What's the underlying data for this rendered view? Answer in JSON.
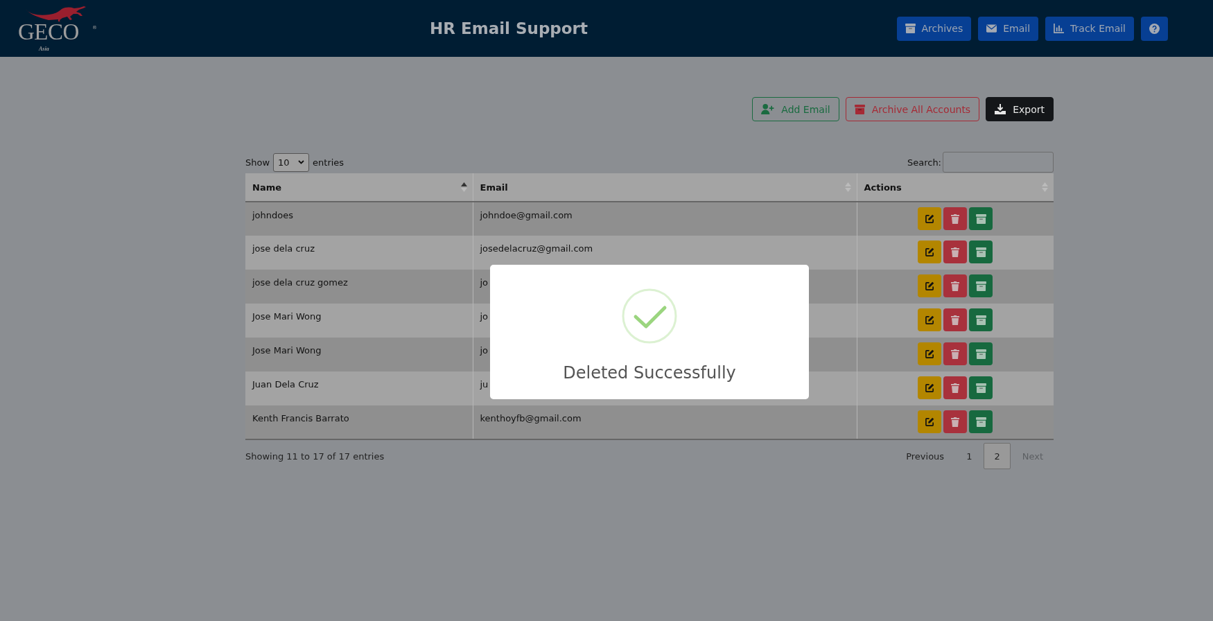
{
  "header": {
    "logo": {
      "name": "GECO",
      "registered": "®",
      "region": "Asia"
    },
    "title": "HR Email Support",
    "buttons": [
      {
        "kind": "archive",
        "label": "Archives"
      },
      {
        "kind": "email",
        "label": "Email"
      },
      {
        "kind": "chart",
        "label": "Track Email"
      },
      {
        "kind": "help"
      }
    ]
  },
  "toolbar": [
    {
      "kind": "add",
      "label": "Add Email"
    },
    {
      "kind": "archive",
      "label": "Archive All Accounts"
    },
    {
      "kind": "export",
      "label": "Export"
    }
  ],
  "length": {
    "prefix": "Show",
    "value": "10",
    "suffix": "entries"
  },
  "search": {
    "label": "Search:"
  },
  "table": {
    "columns": [
      {
        "label": "Name",
        "sorted": true
      },
      {
        "label": "Email",
        "sorted": false
      },
      {
        "label": "Actions",
        "sorted": false
      }
    ],
    "rows": [
      {
        "name": "johndoes",
        "email": "johndoe@gmail.com"
      },
      {
        "name": "jose dela cruz",
        "email": "josedelacruz@gmail.com"
      },
      {
        "name": "jose dela cruz gomez",
        "email": "jo"
      },
      {
        "name": "Jose Mari Wong",
        "email": "jo"
      },
      {
        "name": "Jose Mari Wong",
        "email": "jo"
      },
      {
        "name": "Juan Dela Cruz",
        "email": "ju"
      },
      {
        "name": "Kenth Francis Barrato",
        "email": "kenthoyfb@gmail.com"
      }
    ]
  },
  "info": "Showing 11 to 17 of 17 entries",
  "pagination": {
    "previous": {
      "label": "Previous",
      "disabled": false
    },
    "pages": [
      {
        "label": "1",
        "selected": false
      },
      {
        "label": "2",
        "selected": true
      }
    ],
    "next": {
      "label": "Next",
      "disabled": true
    }
  },
  "modal": {
    "kind": "success",
    "message": "Deleted Successfully"
  }
}
